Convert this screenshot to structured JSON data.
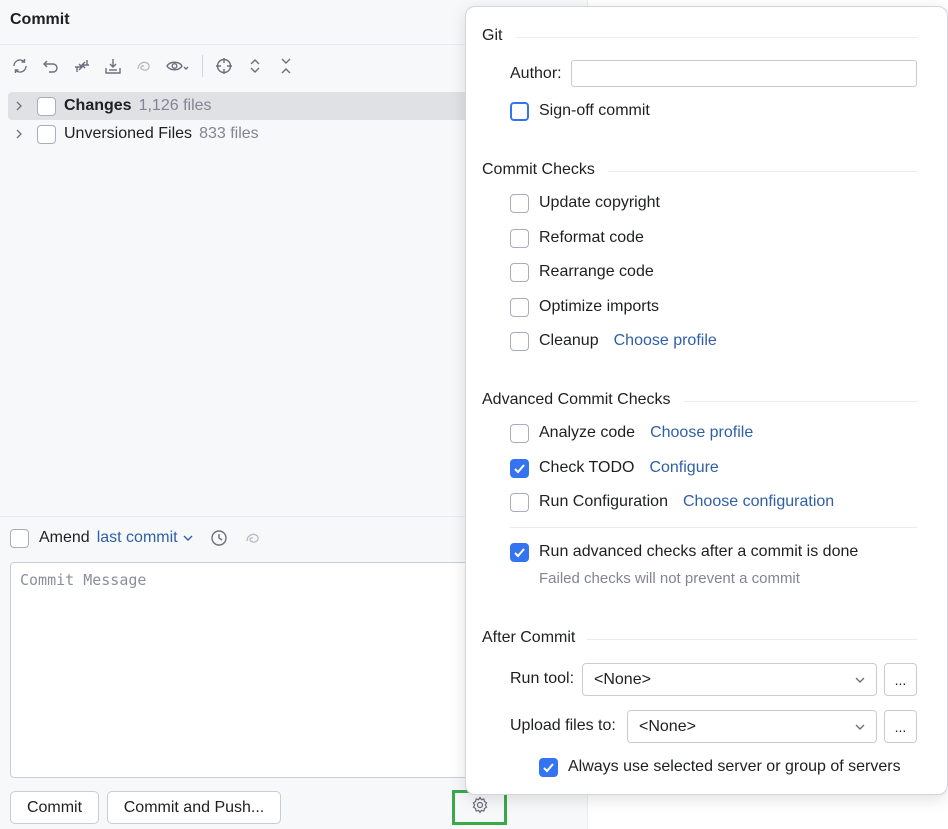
{
  "commit_panel": {
    "title": "Commit",
    "toolbar": {
      "icons": [
        "refresh-icon",
        "rollback-icon",
        "update-icon",
        "shelve-icon",
        "ai-icon",
        "eye-icon",
        "target-icon",
        "expand-all-icon",
        "collapse-all-icon"
      ]
    },
    "tree": [
      {
        "label": "Changes",
        "count": "1,126 files",
        "bold": true,
        "selected": true
      },
      {
        "label": "Unversioned Files",
        "count": "833 files",
        "bold": false,
        "selected": false
      }
    ],
    "amend": {
      "label": "Amend",
      "link": "last commit"
    },
    "message_placeholder": "Commit Message",
    "commit_button": "Commit",
    "commit_push_button": "Commit and Push..."
  },
  "popup": {
    "git": {
      "title": "Git",
      "author_label": "Author:",
      "author_value": "",
      "signoff_label": "Sign-off commit",
      "signoff_checked": false
    },
    "commit_checks": {
      "title": "Commit Checks",
      "items": [
        {
          "label": "Update copyright",
          "checked": false,
          "link": ""
        },
        {
          "label": "Reformat code",
          "checked": false,
          "link": ""
        },
        {
          "label": "Rearrange code",
          "checked": false,
          "link": ""
        },
        {
          "label": "Optimize imports",
          "checked": false,
          "link": ""
        },
        {
          "label": "Cleanup",
          "checked": false,
          "link": "Choose profile"
        }
      ]
    },
    "advanced_checks": {
      "title": "Advanced Commit Checks",
      "items": [
        {
          "label": "Analyze code",
          "checked": false,
          "link": "Choose profile"
        },
        {
          "label": "Check TODO",
          "checked": true,
          "link": "Configure"
        },
        {
          "label": "Run Configuration",
          "checked": false,
          "link": "Choose configuration"
        }
      ],
      "run_after_label": "Run advanced checks after a commit is done",
      "run_after_checked": true,
      "run_after_hint": "Failed checks will not prevent a commit"
    },
    "after_commit": {
      "title": "After Commit",
      "run_tool_label": "Run tool:",
      "run_tool_value": "<None>",
      "upload_label": "Upload files to:",
      "upload_value": "<None>",
      "dots_label": "...",
      "always_use_label": "Always use selected server or group of servers",
      "always_use_checked": true
    }
  },
  "colors": {
    "accent": "#3574f0",
    "link": "#2f5fa6",
    "highlight": "#3ba94a"
  }
}
